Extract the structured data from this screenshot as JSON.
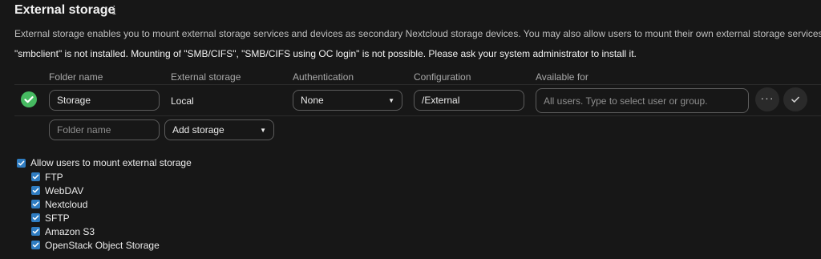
{
  "section": {
    "title": "External storage",
    "info_icon_glyph": "i",
    "description": "External storage enables you to mount external storage services and devices as secondary Nextcloud storage devices. You may also allow users to mount their own external storage services.",
    "warning": "\"smbclient\" is not installed. Mounting of \"SMB/CIFS\", \"SMB/CIFS using OC login\" is not possible. Please ask your system administrator to install it."
  },
  "table": {
    "headers": [
      "Folder name",
      "External storage",
      "Authentication",
      "Configuration",
      "Available for"
    ],
    "row": {
      "status_icon": "check-circle-icon",
      "folder_name": "Storage",
      "external_storage": "Local",
      "authentication": "None",
      "configuration": "/External",
      "available_for_placeholder": "All users. Type to select user or group.",
      "more_icon": "ellipsis-icon",
      "save_icon": "checkmark-icon"
    },
    "new_row": {
      "folder_name_placeholder": "Folder name",
      "add_storage_label": "Add storage"
    }
  },
  "user_mounting": {
    "label": "Allow users to mount external storage",
    "checked": true,
    "backends": [
      {
        "label": "FTP",
        "checked": true
      },
      {
        "label": "WebDAV",
        "checked": true
      },
      {
        "label": "Nextcloud",
        "checked": true
      },
      {
        "label": "SFTP",
        "checked": true
      },
      {
        "label": "Amazon S3",
        "checked": true
      },
      {
        "label": "OpenStack Object Storage",
        "checked": true
      }
    ]
  },
  "colors": {
    "background": "#171717",
    "success": "#46ba61",
    "checkbox": "#2f7dc2"
  }
}
